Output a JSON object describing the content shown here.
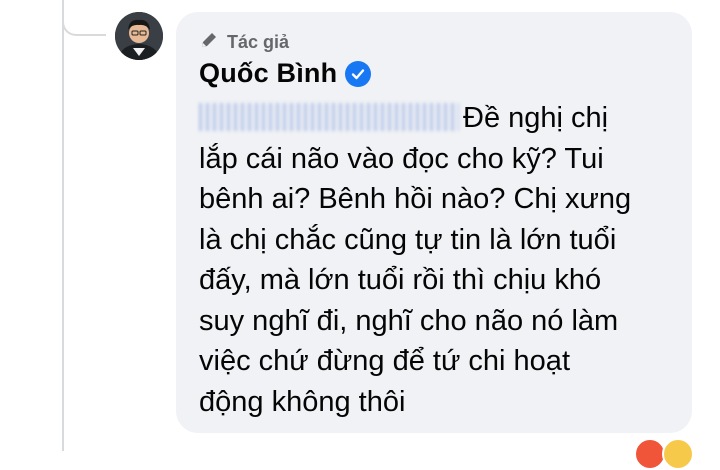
{
  "comment": {
    "badge_label": "Tác giả",
    "author_name": "Quốc Bình",
    "text_lines": [
      "Đề nghị chị",
      "lắp cái não vào đọc cho kỹ? Tui",
      "bênh ai? Bênh hồi nào? Chị xưng",
      "là chị chắc cũng tự tin là lớn tuổi",
      "đấy, mà lớn tuổi rồi thì chịu khó",
      "suy nghĩ đi, nghĩ cho não nó làm",
      "việc chứ đừng để tứ chi hoạt",
      "động không thôi"
    ]
  },
  "colors": {
    "bubble": "#f0f2f5",
    "verified": "#1877f2",
    "badge_text": "#65676b",
    "text": "#050505"
  },
  "icons": [
    "pencil-icon",
    "verified-icon",
    "avatar-photo",
    "haha-reaction-icon",
    "love-reaction-icon"
  ]
}
